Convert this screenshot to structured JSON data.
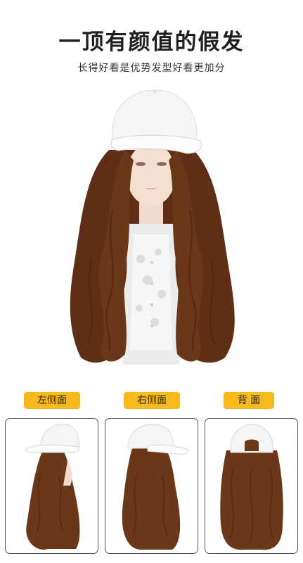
{
  "header": {
    "title": "一顶有颜值的假发",
    "subtitle": "长得好看是优势发型好看更加分"
  },
  "views": [
    {
      "label": "左侧面",
      "icon": "left-side-view"
    },
    {
      "label": "右侧面",
      "icon": "right-side-view"
    },
    {
      "label": "背 面",
      "icon": "back-view"
    }
  ],
  "colors": {
    "badge": "#f7b91c",
    "hair": "#6a3719",
    "hair_dark": "#4a2410",
    "cap": "#f4f4f4",
    "frame_border": "#555555"
  }
}
